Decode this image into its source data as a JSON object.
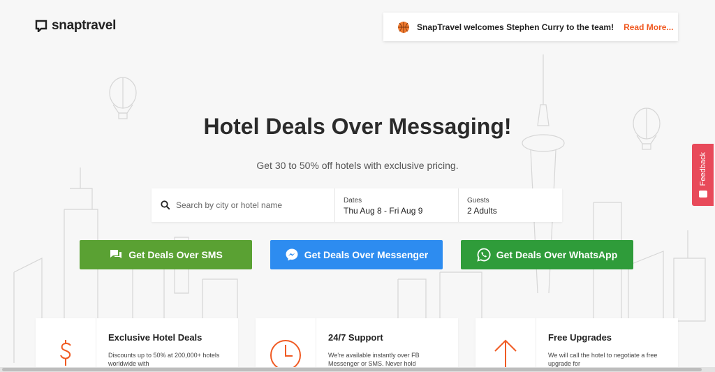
{
  "brand": {
    "name": "snaptravel"
  },
  "announcement": {
    "text": "SnapTravel welcomes Stephen Curry to the team!",
    "link": "Read More..."
  },
  "hero": {
    "title": "Hotel Deals Over Messaging!",
    "subtitle": "Get 30 to 50% off hotels with exclusive pricing."
  },
  "search": {
    "placeholder": "Search by city or hotel name",
    "dates_label": "Dates",
    "dates_value": "Thu Aug 8 - Fri Aug 9",
    "guests_label": "Guests",
    "guests_value": "2 Adults"
  },
  "buttons": {
    "sms": "Get Deals Over SMS",
    "messenger": "Get Deals Over Messenger",
    "whatsapp": "Get Deals Over WhatsApp"
  },
  "feedback": {
    "label": "Feedback"
  },
  "features": [
    {
      "title": "Exclusive Hotel Deals",
      "desc": "Discounts up to 50% at 200,000+ hotels worldwide with",
      "icon": "dollar-icon"
    },
    {
      "title": "24/7 Support",
      "desc": "We're available instantly over FB Messenger or SMS. Never hold",
      "icon": "clock-icon"
    },
    {
      "title": "Free Upgrades",
      "desc": "We will call the hotel to negotiate a free upgrade for",
      "icon": "arrow-up-icon"
    }
  ],
  "colors": {
    "accent": "#f05a22",
    "sms": "#5aa133",
    "messenger": "#2d8cf0",
    "whatsapp": "#2f9c3a",
    "feedback": "#e84a5a"
  }
}
